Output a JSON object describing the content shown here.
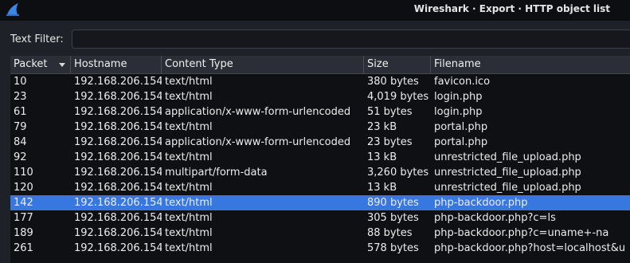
{
  "window": {
    "title": "Wireshark · Export · HTTP object list"
  },
  "filter": {
    "label": "Text Filter:",
    "value": ""
  },
  "table": {
    "columns": [
      "Packet",
      "Hostname",
      "Content Type",
      "Size",
      "Filename"
    ],
    "sorted_column": "Packet",
    "selected_packet": "142",
    "rows": [
      {
        "packet": "10",
        "hostname": "192.168.206.154",
        "content_type": "text/html",
        "size": "380 bytes",
        "filename": "favicon.ico"
      },
      {
        "packet": "23",
        "hostname": "192.168.206.154",
        "content_type": "text/html",
        "size": "4,019 bytes",
        "filename": "login.php"
      },
      {
        "packet": "61",
        "hostname": "192.168.206.154",
        "content_type": "application/x-www-form-urlencoded",
        "size": "51 bytes",
        "filename": "login.php"
      },
      {
        "packet": "79",
        "hostname": "192.168.206.154",
        "content_type": "text/html",
        "size": "23 kB",
        "filename": "portal.php"
      },
      {
        "packet": "84",
        "hostname": "192.168.206.154",
        "content_type": "application/x-www-form-urlencoded",
        "size": "23 bytes",
        "filename": "portal.php"
      },
      {
        "packet": "92",
        "hostname": "192.168.206.154",
        "content_type": "text/html",
        "size": "13 kB",
        "filename": "unrestricted_file_upload.php"
      },
      {
        "packet": "110",
        "hostname": "192.168.206.154",
        "content_type": "multipart/form-data",
        "size": "3,260 bytes",
        "filename": "unrestricted_file_upload.php"
      },
      {
        "packet": "120",
        "hostname": "192.168.206.154",
        "content_type": "text/html",
        "size": "13 kB",
        "filename": "unrestricted_file_upload.php"
      },
      {
        "packet": "142",
        "hostname": "192.168.206.154",
        "content_type": "text/html",
        "size": "890 bytes",
        "filename": "php-backdoor.php"
      },
      {
        "packet": "177",
        "hostname": "192.168.206.154",
        "content_type": "text/html",
        "size": "305 bytes",
        "filename": "php-backdoor.php?c=ls"
      },
      {
        "packet": "189",
        "hostname": "192.168.206.154",
        "content_type": "text/html",
        "size": "88 bytes",
        "filename": "php-backdoor.php?c=uname+-na"
      },
      {
        "packet": "261",
        "hostname": "192.168.206.154",
        "content_type": "text/html",
        "size": "578 bytes",
        "filename": "php-backdoor.php?host=localhost&u"
      }
    ]
  },
  "colors": {
    "selection": "#3678e0",
    "app_icon": "#3a86e8"
  }
}
